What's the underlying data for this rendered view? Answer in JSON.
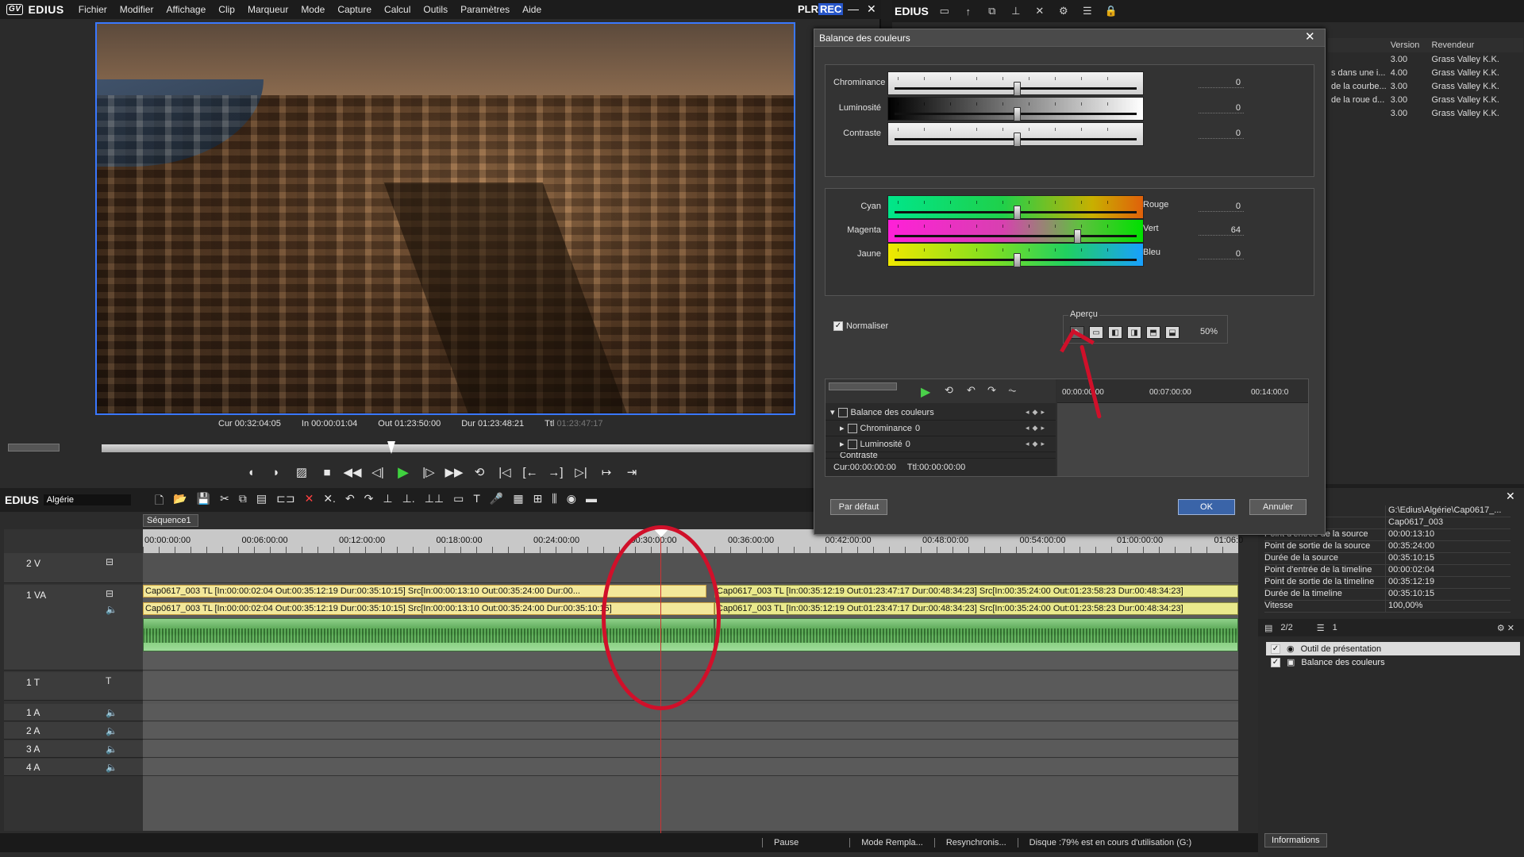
{
  "player": {
    "app_name": "EDIUS",
    "gv_logo": "GV",
    "menu": [
      "Fichier",
      "Modifier",
      "Affichage",
      "Clip",
      "Marqueur",
      "Mode",
      "Capture",
      "Calcul",
      "Outils",
      "Paramètres",
      "Aide"
    ],
    "plr": "PLR",
    "rec": "REC",
    "timecodes": {
      "cur_label": "Cur",
      "cur": "00:32:04:05",
      "in_label": "In",
      "in": "00:00:01:04",
      "out_label": "Out",
      "out": "01:23:50:00",
      "dur_label": "Dur",
      "dur": "01:23:48:21",
      "ttl_label": "Ttl",
      "ttl": "01:23:47:17"
    }
  },
  "palette": {
    "app_name": "EDIUS",
    "columns": [
      "",
      "Version",
      "Revendeur"
    ],
    "rows": [
      {
        "name": "",
        "version": "3.00",
        "vendor": "Grass Valley K.K."
      },
      {
        "name": "s dans une i...",
        "version": "4.00",
        "vendor": "Grass Valley K.K."
      },
      {
        "name": "de la courbe...",
        "version": "3.00",
        "vendor": "Grass Valley K.K."
      },
      {
        "name": "de la roue d...",
        "version": "3.00",
        "vendor": "Grass Valley K.K."
      },
      {
        "name": "",
        "version": "3.00",
        "vendor": "Grass Valley K.K."
      }
    ]
  },
  "dialog": {
    "title": "Balance des couleurs",
    "sliders_top": [
      {
        "label": "Chrominance",
        "value": "0",
        "level": 0.5
      },
      {
        "label": "Luminosité",
        "value": "0",
        "level": 0.5
      },
      {
        "label": "Contraste",
        "value": "0",
        "level": 0.5
      }
    ],
    "sliders_color": [
      {
        "left": "Cyan",
        "right": "Rouge",
        "value": "0",
        "level": 0.5
      },
      {
        "left": "Magenta",
        "right": "Vert",
        "value": "64",
        "level": 0.75
      },
      {
        "left": "Jaune",
        "right": "Bleu",
        "value": "0",
        "level": 0.5
      }
    ],
    "normaliser": "Normaliser",
    "apercu": "Aperçu",
    "apercu_pct": "50%",
    "keyframes": {
      "rows": [
        "Balance des couleurs",
        "Chrominance",
        "Luminosité",
        "Contraste"
      ],
      "chroma_val": "0",
      "lum_val": "0",
      "cur": "Cur:00:00:00:00",
      "ttl": "Ttl:00:00:00:00",
      "ruler": [
        "00:00:00:00",
        "00:07:00:00",
        "00:14:00:0"
      ]
    },
    "btn_default": "Par défaut",
    "btn_ok": "OK",
    "btn_cancel": "Annuler"
  },
  "timeline": {
    "app_name": "EDIUS",
    "project": "Algérie",
    "sequence": "Séquence1",
    "ruler": [
      "00:00:00:00",
      "00:06:00:00",
      "00:12:00:00",
      "00:18:00:00",
      "00:24:00:00",
      "00:30:00:00",
      "00:36:00:00",
      "00:42:00:00",
      "00:48:00:00",
      "00:54:00:00",
      "01:00:00:00",
      "01:06:0"
    ],
    "tracks": [
      "2 V",
      "1 VA",
      "1 T",
      "1 A",
      "2 A",
      "3 A",
      "4 A"
    ],
    "clip1_video": "Cap0617_003  TL [In:00:00:02:04  Out:00:35:12:19  Dur:00:35:10:15]  Src[In:00:00:13:10  Out:00:35:24:00  Dur:00...",
    "clip1_audio": "Cap0617_003  TL [In:00:00:02:04  Out:00:35:12:19  Dur:00:35:10:15]  Src[In:00:00:13:10  Out:00:35:24:00  Dur:00:35:10:15]",
    "clip2_video": "Cap0617_003  TL [In:00:35:12:19  Out:01:23:47:17  Dur:00:48:34:23]  Src[In:00:35:24:00  Out:01:23:58:23  Dur:00:48:34:23]",
    "clip2_audio": "Cap0617_003  TL [In:00:35:12:19  Out:01:23:47:17  Dur:00:48:34:23]  Src[In:00:35:24:00  Out:01:23:58:23  Dur:00:48:34:23]"
  },
  "status": {
    "pause": "Pause",
    "mode": "Mode Rempla...",
    "sync": "Resynchronis...",
    "disk": "Disque :79% est en cours d'utilisation (G:)"
  },
  "info": {
    "rows": [
      {
        "k": "",
        "v": "G:\\Edius\\Algérie\\Cap0617_..."
      },
      {
        "k": "",
        "v": "Cap0617_003"
      },
      {
        "k": "Point d'entrée de la source",
        "v": "00:00:13:10"
      },
      {
        "k": "Point de sortie de la source",
        "v": "00:35:24:00"
      },
      {
        "k": "Durée de la source",
        "v": "00:35:10:15"
      },
      {
        "k": "Point d'entrée de la timeline",
        "v": "00:00:02:04"
      },
      {
        "k": "Point de sortie de la timeline",
        "v": "00:35:12:19"
      },
      {
        "k": "Durée de la timeline",
        "v": "00:35:10:15"
      },
      {
        "k": "Vitesse",
        "v": "100,00%"
      }
    ],
    "page": "2/2",
    "count": "1",
    "effects": [
      "Outil de présentation",
      "Balance des couleurs"
    ],
    "tab": "Informations"
  }
}
